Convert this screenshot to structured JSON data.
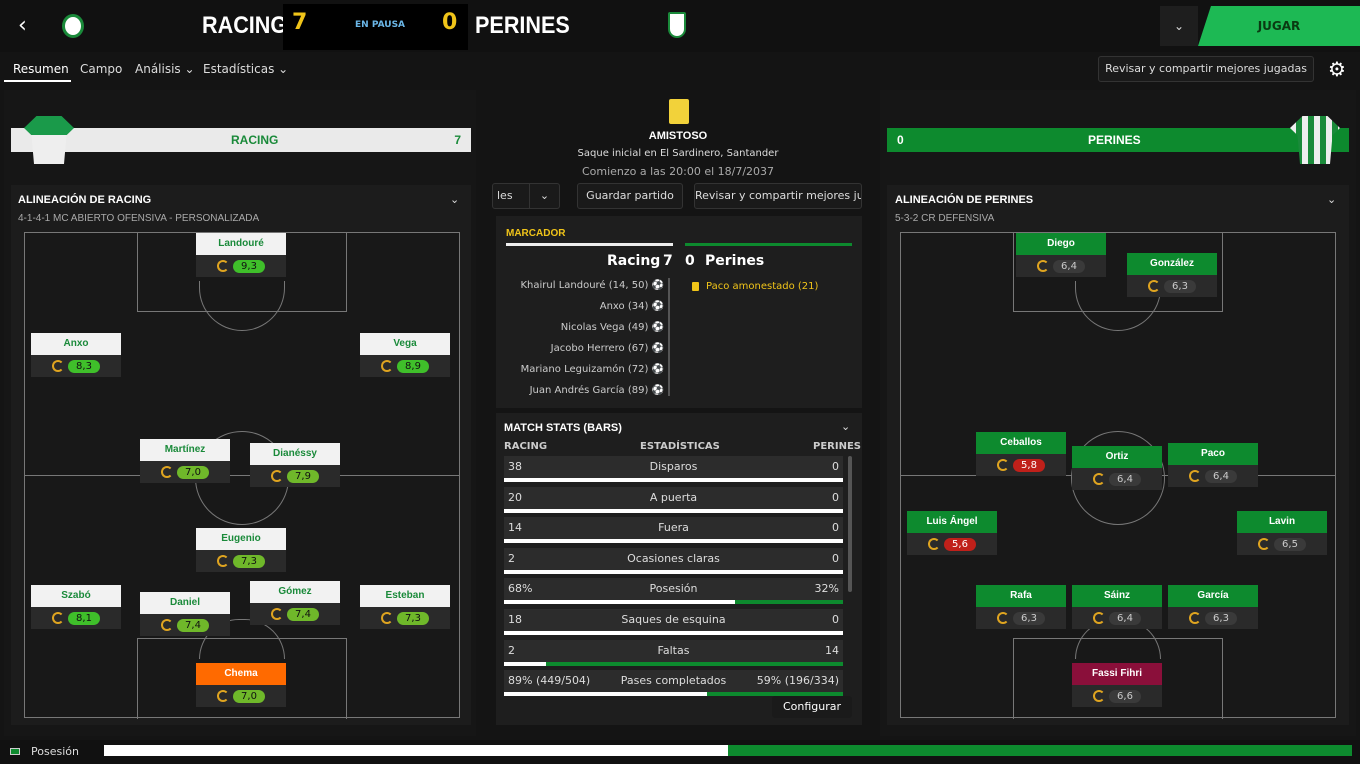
{
  "header": {
    "back_icon": "‹",
    "home": "RACING",
    "home_score": "7",
    "status": "EN PAUSA",
    "away_score": "0",
    "away": "PERINES",
    "dropdown_icon": "⌄",
    "play": "JUGAR"
  },
  "tabs": [
    {
      "label": "Resumen"
    },
    {
      "label": "Campo"
    },
    {
      "label": "Análisis ⌄"
    },
    {
      "label": "Estadísticas ⌄"
    }
  ],
  "review_top": "Revisar y compartir mejores jugadas",
  "gear_icon": "⚙",
  "home_bar": {
    "name": "RACING",
    "score": "7"
  },
  "away_bar": {
    "name": "PERINES",
    "score": "0"
  },
  "home_lineup": {
    "title": "ALINEACIÓN DE RACING",
    "formation": "4-1-4-1 MC ABIERTO OFENSIVA - PERSONALIZADA"
  },
  "away_lineup": {
    "title": "ALINEACIÓN DE PERINES",
    "formation": "5-3-2 CR DEFENSIVA"
  },
  "home_players": [
    {
      "name": "Landouré",
      "rating": "9,3",
      "color": "#3fbf2a"
    },
    {
      "name": "Anxo",
      "rating": "8,3",
      "color": "#3fbf2a"
    },
    {
      "name": "Vega",
      "rating": "8,9",
      "color": "#3fbf2a"
    },
    {
      "name": "Martínez",
      "rating": "7,0",
      "color": "#6fb82a"
    },
    {
      "name": "Dianéssy",
      "rating": "7,9",
      "color": "#6fb82a"
    },
    {
      "name": "Eugenio",
      "rating": "7,3",
      "color": "#6fb82a"
    },
    {
      "name": "Szabó",
      "rating": "8,1",
      "color": "#3fbf2a"
    },
    {
      "name": "Daniel",
      "rating": "7,4",
      "color": "#6fb82a"
    },
    {
      "name": "Gómez",
      "rating": "7,4",
      "color": "#6fb82a"
    },
    {
      "name": "Esteban",
      "rating": "7,3",
      "color": "#6fb82a"
    },
    {
      "name": "Chema",
      "rating": "7,0",
      "color": "#6fb82a"
    }
  ],
  "away_players": [
    {
      "name": "Diego",
      "rating": "6,4",
      "color": "#3a3a3a"
    },
    {
      "name": "González",
      "rating": "6,3",
      "color": "#3a3a3a"
    },
    {
      "name": "Ceballos",
      "rating": "5,8",
      "color": "#c0201a"
    },
    {
      "name": "Ortiz",
      "rating": "6,4",
      "color": "#3a3a3a"
    },
    {
      "name": "Paco",
      "rating": "6,4",
      "color": "#3a3a3a"
    },
    {
      "name": "Luis Ángel",
      "rating": "5,6",
      "color": "#c0201a"
    },
    {
      "name": "Lavin",
      "rating": "6,5",
      "color": "#3a3a3a"
    },
    {
      "name": "Rafa",
      "rating": "6,3",
      "color": "#3a3a3a"
    },
    {
      "name": "Sáinz",
      "rating": "6,4",
      "color": "#3a3a3a"
    },
    {
      "name": "García",
      "rating": "6,3",
      "color": "#3a3a3a"
    },
    {
      "name": "Fassi Fihri",
      "rating": "6,6",
      "color": "#3a3a3a"
    }
  ],
  "match": {
    "competition": "AMISTOSO",
    "venue": "Saque inicial en El Sardinero, Santander",
    "time": "Comienzo a las 20:00 el 18/7/2037"
  },
  "buttons": {
    "partial": "les",
    "save": "Guardar partido",
    "review": "Revisar y compartir mejores ju"
  },
  "marcador": {
    "title": "MARCADOR",
    "home": "Racing",
    "home_score": "7",
    "away_score": "0",
    "away": "Perines",
    "home_events": [
      "Khairul Landouré (14, 50)",
      "Anxo (34)",
      "Nicolas Vega (49)",
      "Jacobo Herrero (67)",
      "Mariano Leguizamón (72)",
      "Juan Andrés García (89)"
    ],
    "away_events": [
      "Paco amonestado (21)"
    ]
  },
  "stats": {
    "title": "MATCH STATS (BARS)",
    "col_home": "RACING",
    "col_mid": "ESTADÍSTICAS",
    "col_away": "PERINES",
    "rows": [
      {
        "label": "Disparos",
        "home": "38",
        "away": "0",
        "home_frac": 1.0
      },
      {
        "label": "A puerta",
        "home": "20",
        "away": "0",
        "home_frac": 1.0
      },
      {
        "label": "Fuera",
        "home": "14",
        "away": "0",
        "home_frac": 1.0
      },
      {
        "label": "Ocasiones claras",
        "home": "2",
        "away": "0",
        "home_frac": 1.0
      },
      {
        "label": "Posesión",
        "home": "68%",
        "away": "32%",
        "home_frac": 0.68
      },
      {
        "label": "Saques de esquina",
        "home": "18",
        "away": "0",
        "home_frac": 1.0
      },
      {
        "label": "Faltas",
        "home": "2",
        "away": "14",
        "home_frac": 0.125
      },
      {
        "label": "Pases completados",
        "home": "89% (449/504)",
        "away": "59% (196/334)",
        "home_frac": 0.6
      }
    ],
    "configure": "Configurar"
  },
  "footer": {
    "label": "Posesión",
    "home_fraction": 0.5
  }
}
